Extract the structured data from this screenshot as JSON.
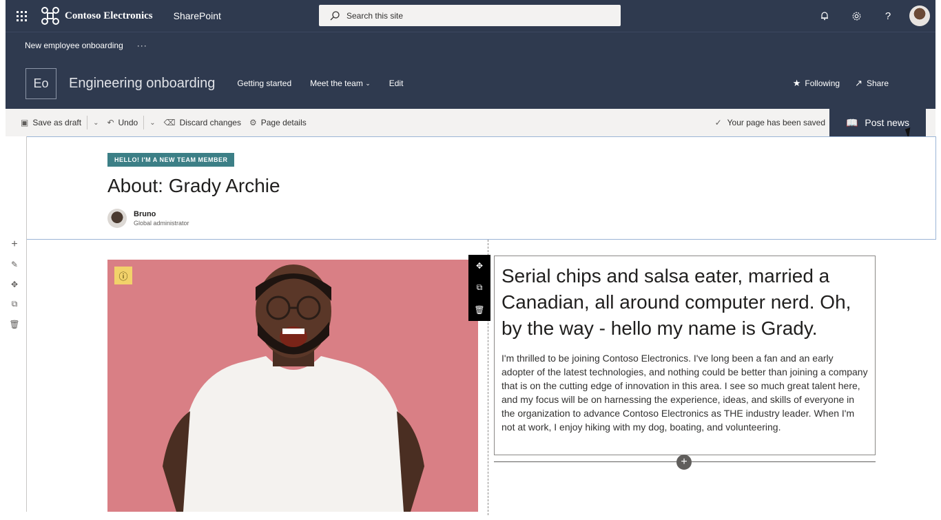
{
  "suite": {
    "brand_name": "Contoso Electronics",
    "app_name": "SharePoint",
    "search_placeholder": "Search this site"
  },
  "hub": {
    "site_name": "New employee onboarding",
    "more": "···"
  },
  "site": {
    "logo_text": "Eo",
    "title": "Engineering onboarding",
    "nav": [
      "Getting started",
      "Meet the team",
      "Edit"
    ],
    "following": "Following",
    "share": "Share"
  },
  "commandbar": {
    "save_as_draft": "Save as draft",
    "undo": "Undo",
    "discard": "Discard changes",
    "page_details": "Page details",
    "saved_status": "Your page has been saved",
    "post_news": "Post news"
  },
  "page": {
    "tag": "HELLO! I'M A NEW TEAM MEMBER",
    "title": "About: Grady Archie",
    "author_name": "Bruno",
    "author_role": "Global administrator",
    "lead": "Serial chips and salsa eater, married a Canadian, all around computer nerd. Oh, by the way - hello my name is Grady.",
    "body": "I'm thrilled to be joining Contoso Electronics. I've long been a fan and an early adopter of the latest technologies, and nothing could be better than joining a company that is on the cutting edge of innovation in this area. I see so much great talent here, and my focus will be on harnessing the experience, ideas, and skills of everyone in the organization to advance Contoso Electronics as THE industry leader. When I'm not at work, I enjoy hiking with my dog, boating, and volunteering."
  },
  "colors": {
    "suite_bg": "#2f3a4f",
    "tag_bg": "#3c7f86",
    "photo_bg": "#d97f85",
    "warning": "#f2d26a"
  },
  "icons": [
    "waffle-icon",
    "contoso-logo-icon",
    "search-icon",
    "notification-icon",
    "settings-icon",
    "help-icon",
    "star-icon",
    "share-icon",
    "save-icon",
    "undo-icon",
    "discard-icon",
    "page-details-icon",
    "checkmark-icon",
    "news-icon",
    "add-icon",
    "edit-icon",
    "move-icon",
    "duplicate-icon",
    "delete-icon",
    "info-icon"
  ]
}
